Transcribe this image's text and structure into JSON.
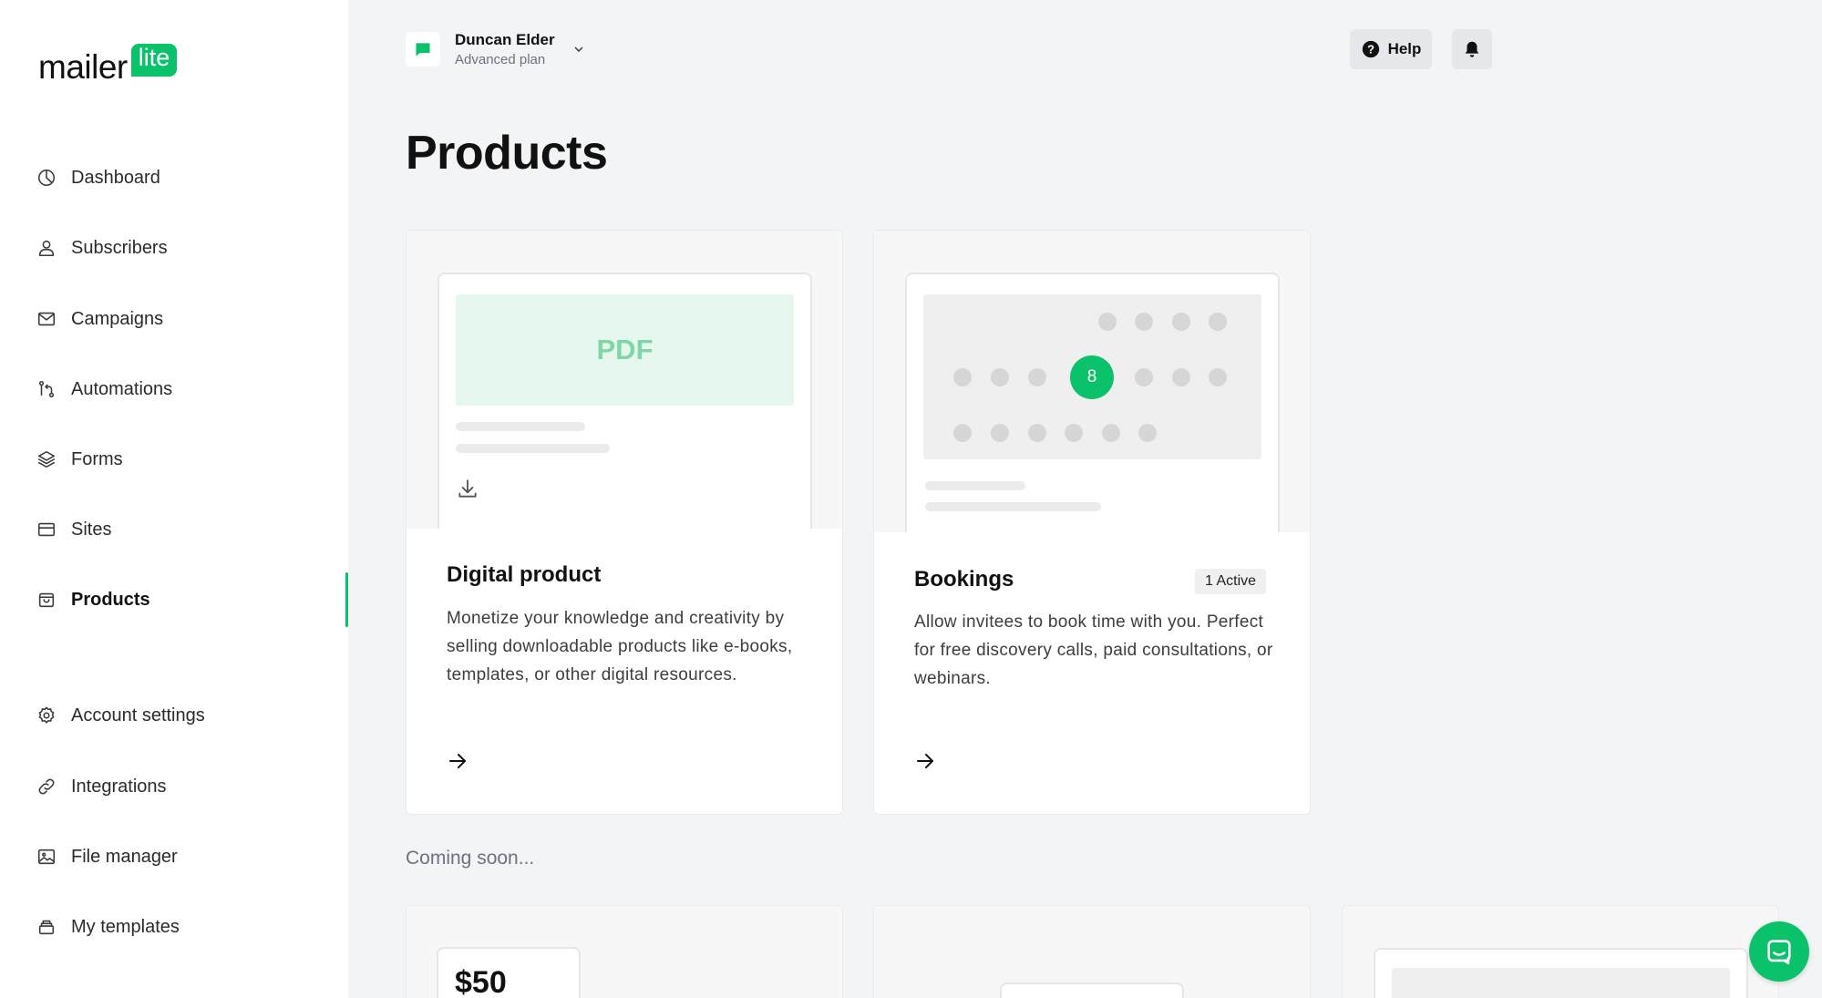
{
  "brand": {
    "logo_main": "mailer",
    "logo_badge": "lite",
    "accent": "#09c269"
  },
  "account": {
    "name": "Duncan Elder",
    "plan": "Advanced plan"
  },
  "header": {
    "help_label": "Help"
  },
  "sidebar": {
    "items": [
      {
        "label": "Dashboard",
        "icon": "dashboard-icon"
      },
      {
        "label": "Subscribers",
        "icon": "user-icon"
      },
      {
        "label": "Campaigns",
        "icon": "mail-icon"
      },
      {
        "label": "Automations",
        "icon": "automation-icon"
      },
      {
        "label": "Forms",
        "icon": "layers-icon"
      },
      {
        "label": "Sites",
        "icon": "browser-icon"
      },
      {
        "label": "Products",
        "icon": "shopping-bag-icon",
        "active": true
      },
      {
        "label": "Account settings",
        "icon": "gear-icon"
      },
      {
        "label": "Integrations",
        "icon": "link-icon"
      },
      {
        "label": "File manager",
        "icon": "image-icon"
      },
      {
        "label": "My templates",
        "icon": "templates-icon"
      }
    ]
  },
  "main": {
    "title": "Products",
    "cards": [
      {
        "title": "Digital product",
        "description": "Monetize your knowledge and creativity by selling downloadable products like e-books, templates, or other digital resources.",
        "preview_label": "PDF"
      },
      {
        "title": "Bookings",
        "badge": "1 Active",
        "description": "Allow invitees to book time with you. Perfect for free discovery calls, paid consultations, or webinars.",
        "calendar_day": "8"
      }
    ],
    "coming_soon_label": "Coming soon...",
    "coming_soon_cards": [
      {
        "price": "$50"
      }
    ]
  }
}
